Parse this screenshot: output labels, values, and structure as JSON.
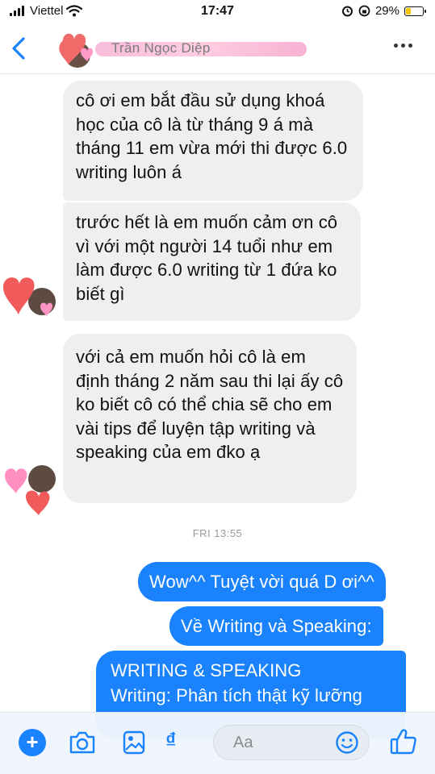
{
  "status_bar": {
    "carrier": "Viettel",
    "time": "17:47",
    "battery": "29%",
    "battery_level": 0.29
  },
  "header": {
    "contact_name": "Trần Ngọc Diệp",
    "icons": {
      "back": "chevron-left-icon",
      "more": "more-dots-icon"
    }
  },
  "messages": {
    "incoming": [
      "cô ơi em bắt đầu sử dụng khoá học của cô là từ tháng 9 á mà tháng 11 em vừa mới thi được 6.0 writing luôn á",
      "trước hết là em muốn cảm ơn cô vì với một người 14 tuổi như em làm được 6.0 writing từ 1 đứa ko biết gì",
      "với cả em muốn hỏi cô là em định tháng 2 năm sau thi lại ấy cô ko biết cô có thể chia sẽ cho em vài tips để luyện tập writing và speaking của em đko ạ"
    ],
    "timestamp": "FRI 13:55",
    "outgoing": [
      "Wow^^ Tuyệt vời quá D ơi^^",
      "Về Writing và Speaking:",
      "WRITING & SPEAKING",
      "Writing: Phân tích thật kỹ lưỡng"
    ]
  },
  "composer": {
    "placeholder": "Aa",
    "dong_symbol": "₫",
    "icons": [
      "plus-icon",
      "camera-icon",
      "image-icon",
      "dong-icon",
      "emoji-icon",
      "thumbs-up-icon"
    ]
  },
  "colors": {
    "accent": "#1982fc",
    "incoming_bubble": "#efeff0",
    "outgoing_bubble": "#1982fc"
  }
}
